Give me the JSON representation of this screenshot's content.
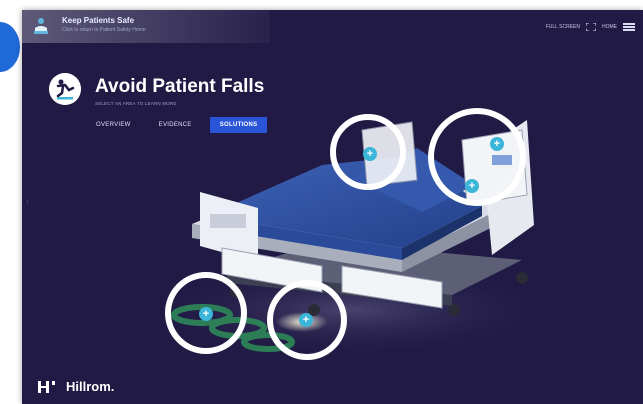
{
  "app": {
    "title": "Keep Patients Safe",
    "subtitle": "Click to return to Patient Safety Home"
  },
  "header": {
    "fullscreen_label": "FULL SCREEN",
    "home_label": "HOME"
  },
  "page": {
    "title": "Avoid Patient Falls",
    "instruction": "SELECT AN AREA TO LEARN MORE"
  },
  "tabs": [
    {
      "label": "OVERVIEW",
      "active": false
    },
    {
      "label": "EVIDENCE",
      "active": false
    },
    {
      "label": "SOLUTIONS",
      "active": true
    }
  ],
  "hotspots": [
    {
      "icon": "plus-icon",
      "symbol": "+"
    },
    {
      "icon": "plus-icon",
      "symbol": "+"
    },
    {
      "icon": "plus-icon",
      "symbol": "+"
    },
    {
      "icon": "plus-icon",
      "symbol": "+"
    },
    {
      "icon": "plus-icon",
      "symbol": "+"
    },
    {
      "icon": "plus-icon",
      "symbol": "+"
    }
  ],
  "nav": {
    "prev_symbol": "‹"
  },
  "brand": {
    "name": "Hillrom."
  },
  "colors": {
    "background": "#201a45",
    "tab_active": "#2a55d9",
    "hotspot_ring": "#ffffff",
    "plus": "#3bb5d8",
    "edge_badge": "#1f6ad8"
  }
}
